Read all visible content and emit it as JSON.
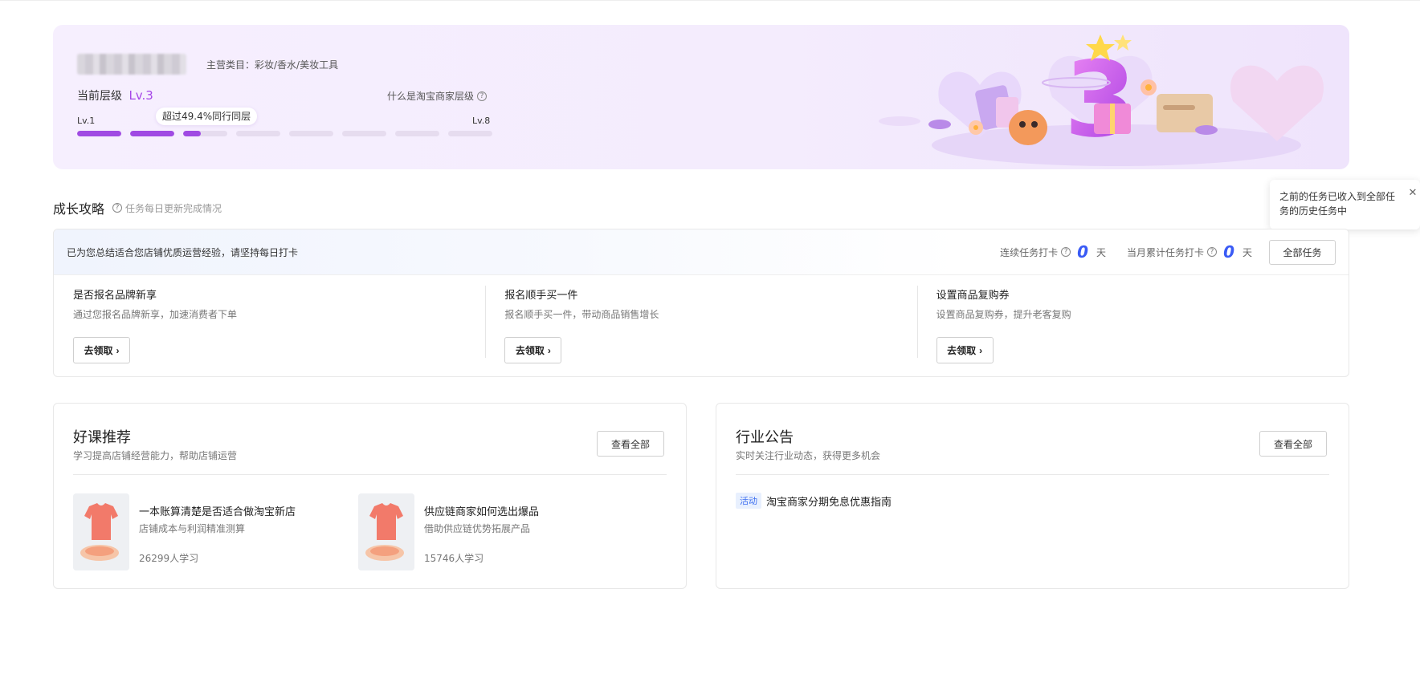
{
  "banner": {
    "category": "主营类目：彩妆/香水/美妆工具",
    "level_label": "当前层级",
    "level_value": "Lv.3",
    "what_is_level": "什么是淘宝商家层级",
    "lv_start": "Lv.1",
    "lv_end": "Lv.8",
    "exceed_tip": "超过49.4%同行同层",
    "progress": [
      1,
      1,
      0.4,
      0,
      0,
      0,
      0,
      0
    ],
    "accent_color": "#a04ae3"
  },
  "growth": {
    "title": "成长攻略",
    "subtitle": "任务每日更新完成情况",
    "tooltip": "之前的任务已收入到全部任务的历史任务中",
    "head_message": "已为您总结适合您店铺优质运营经验，请坚持每日打卡",
    "streak_label": "连续任务打卡",
    "streak_value": "0",
    "monthly_label": "当月累计任务打卡",
    "monthly_value": "0",
    "unit": "天",
    "all_tasks_button": "全部任务",
    "tasks": [
      {
        "title": "是否报名品牌新享",
        "desc": "通过您报名品牌新享，加速消费者下单",
        "button": "去领取"
      },
      {
        "title": "报名顺手买一件",
        "desc": "报名顺手买一件，带动商品销售增长",
        "button": "去领取"
      },
      {
        "title": "设置商品复购券",
        "desc": "设置商品复购券，提升老客复购",
        "button": "去领取"
      }
    ]
  },
  "courses": {
    "title": "好课推荐",
    "subtitle": "学习提高店铺经营能力，帮助店铺运营",
    "view_all": "查看全部",
    "items": [
      {
        "title": "一本账算清楚是否适合做淘宝新店",
        "desc": "店铺成本与利润精准测算",
        "learners": "26299人学习"
      },
      {
        "title": "供应链商家如何选出爆品",
        "desc": "借助供应链优势拓展产品",
        "learners": "15746人学习"
      }
    ]
  },
  "announcements": {
    "title": "行业公告",
    "subtitle": "实时关注行业动态，获得更多机会",
    "view_all": "查看全部",
    "items": [
      {
        "tag": "活动",
        "text": "淘宝商家分期免息优惠指南"
      }
    ]
  }
}
